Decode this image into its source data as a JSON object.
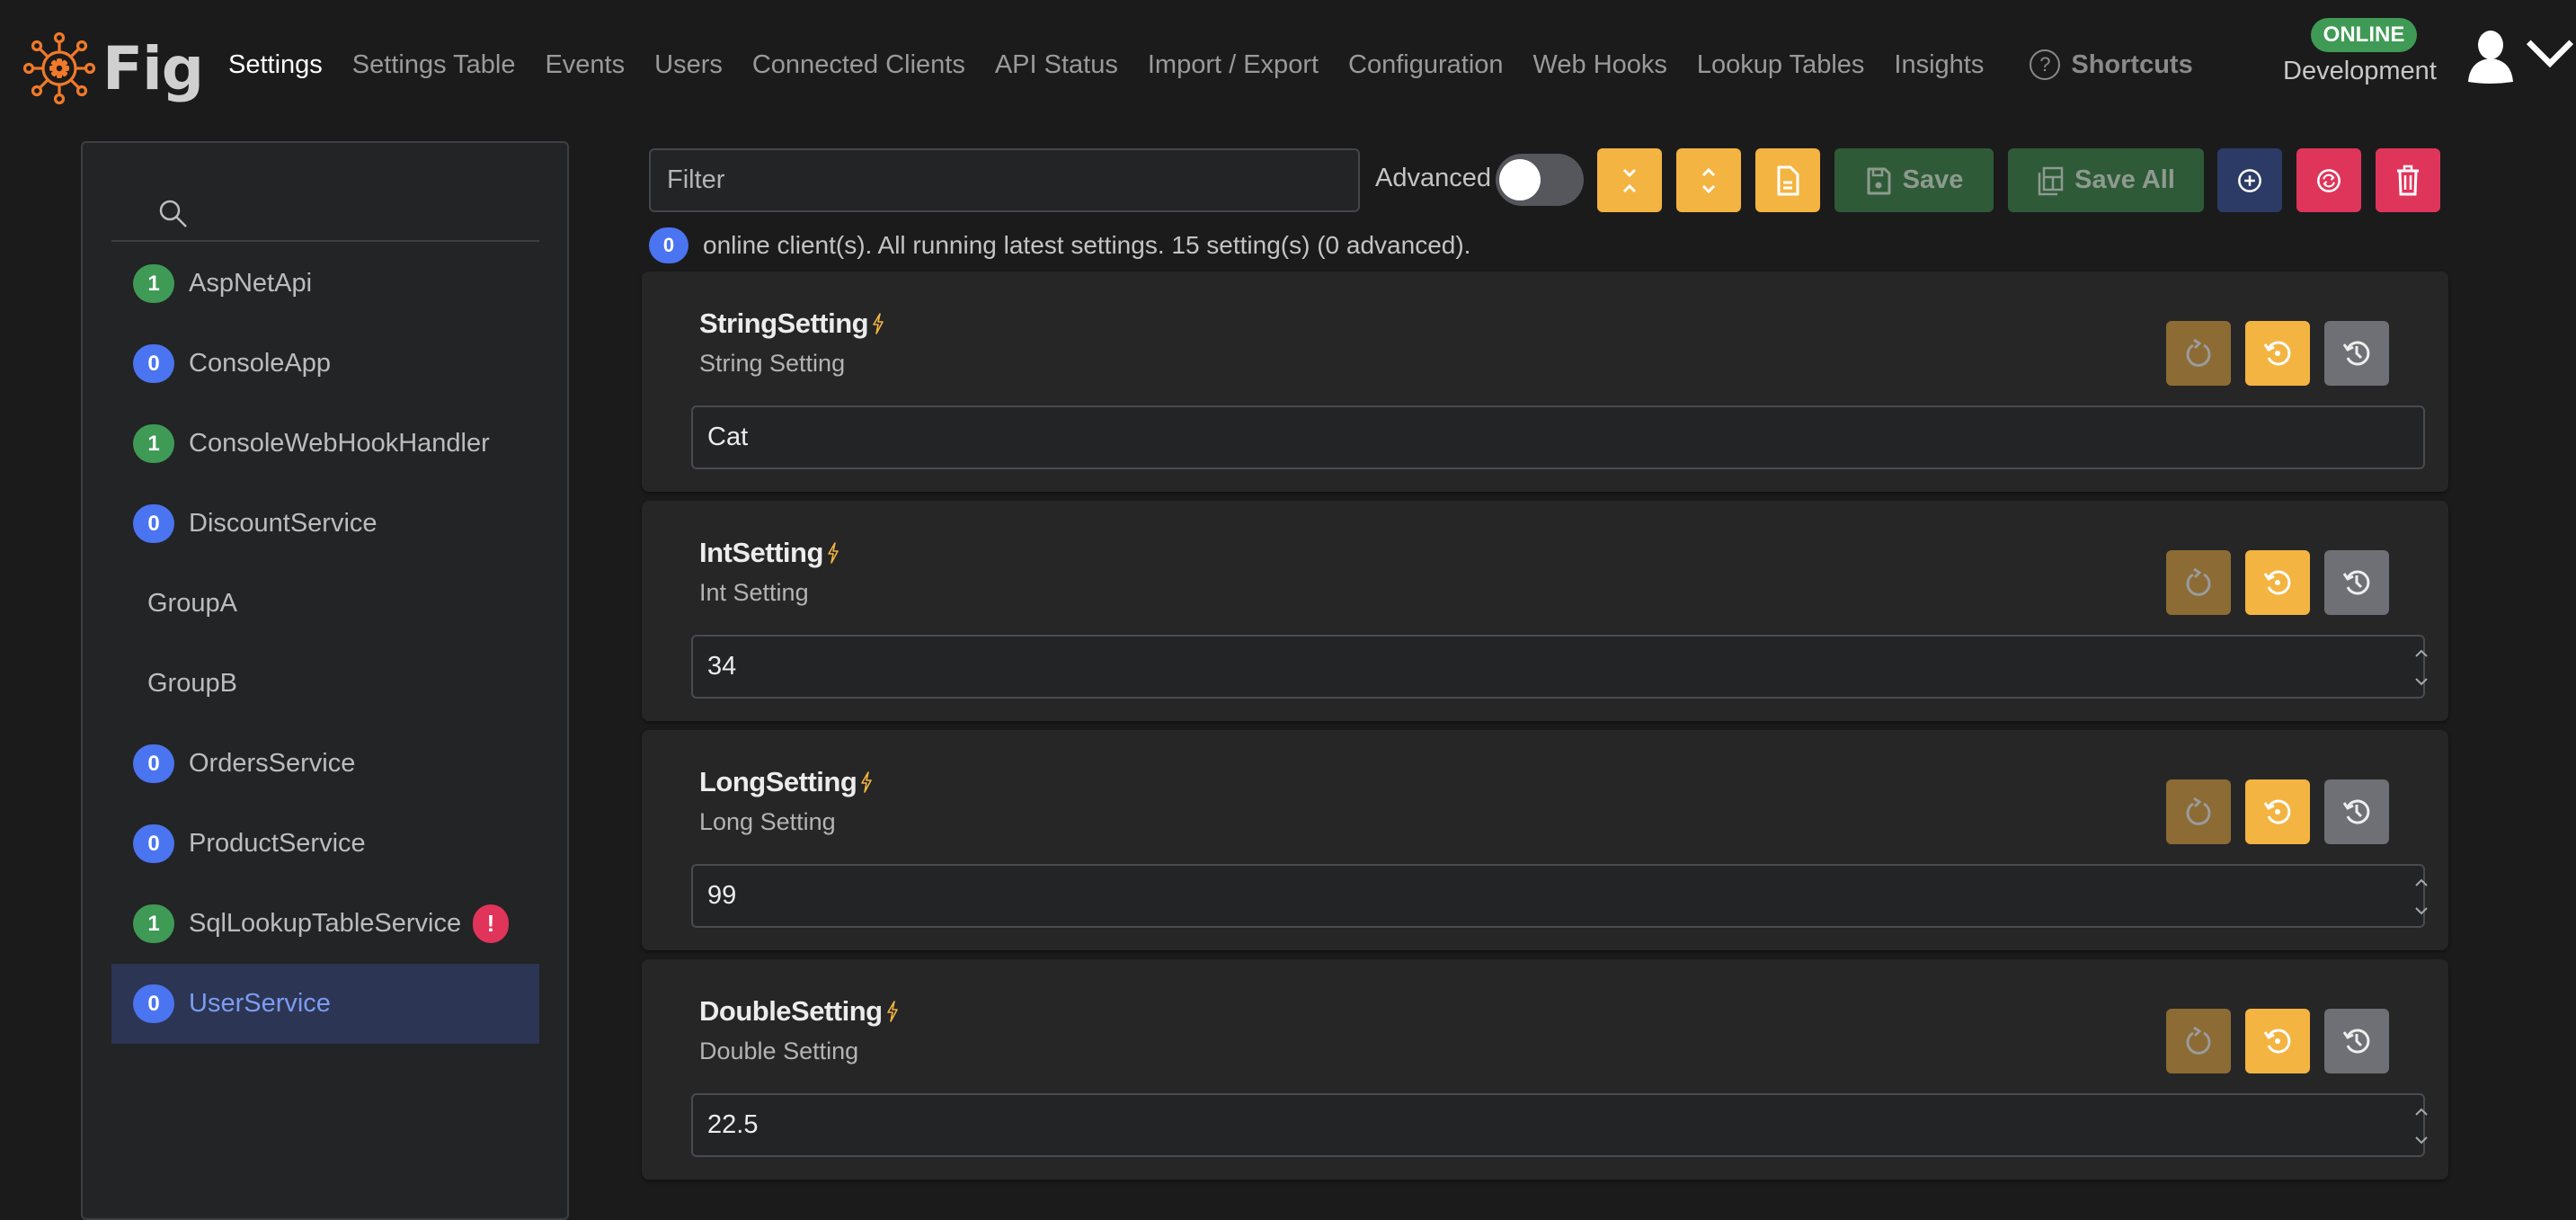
{
  "header": {
    "app_name": "Fig",
    "nav": [
      {
        "label": "Settings",
        "active": true
      },
      {
        "label": "Settings Table",
        "active": false
      },
      {
        "label": "Events",
        "active": false
      },
      {
        "label": "Users",
        "active": false
      },
      {
        "label": "Connected Clients",
        "active": false
      },
      {
        "label": "API Status",
        "active": false
      },
      {
        "label": "Import / Export",
        "active": false
      },
      {
        "label": "Configuration",
        "active": false
      },
      {
        "label": "Web Hooks",
        "active": false
      },
      {
        "label": "Lookup Tables",
        "active": false
      },
      {
        "label": "Insights",
        "active": false
      }
    ],
    "shortcuts_label": "Shortcuts",
    "shortcuts_icon": "question-circle-icon",
    "status_badge": "ONLINE",
    "environment": "Development",
    "user_icon": "user-avatar-icon"
  },
  "sidebar": {
    "search_placeholder": "",
    "items": [
      {
        "label": "AspNetApi",
        "count": "1",
        "badge_color": "green",
        "error": false,
        "selected": false,
        "group": false
      },
      {
        "label": "ConsoleApp",
        "count": "0",
        "badge_color": "blue",
        "error": false,
        "selected": false,
        "group": false
      },
      {
        "label": "ConsoleWebHookHandler",
        "count": "1",
        "badge_color": "green",
        "error": false,
        "selected": false,
        "group": false
      },
      {
        "label": "DiscountService",
        "count": "0",
        "badge_color": "blue",
        "error": false,
        "selected": false,
        "group": false
      },
      {
        "label": "GroupA",
        "count": null,
        "badge_color": null,
        "error": false,
        "selected": false,
        "group": true
      },
      {
        "label": "GroupB",
        "count": null,
        "badge_color": null,
        "error": false,
        "selected": false,
        "group": true
      },
      {
        "label": "OrdersService",
        "count": "0",
        "badge_color": "blue",
        "error": false,
        "selected": false,
        "group": false
      },
      {
        "label": "ProductService",
        "count": "0",
        "badge_color": "blue",
        "error": false,
        "selected": false,
        "group": false
      },
      {
        "label": "SqlLookupTableService",
        "count": "1",
        "badge_color": "green",
        "error": true,
        "error_glyph": "!",
        "selected": false,
        "group": false
      },
      {
        "label": "UserService",
        "count": "0",
        "badge_color": "blue",
        "error": false,
        "selected": true,
        "group": false
      }
    ]
  },
  "toolbar": {
    "filter_placeholder": "Filter",
    "filter_value": "",
    "advanced_label": "Advanced",
    "advanced_on": false,
    "buttons": {
      "collapse_all_icon": "collapse-all-icon",
      "expand_all_icon": "expand-all-icon",
      "description_icon": "document-icon",
      "save_label": "Save",
      "save_all_label": "Save All",
      "add_instance_icon": "plus-circle-icon",
      "refresh_icon": "refresh-circle-icon",
      "delete_icon": "trash-icon"
    }
  },
  "status": {
    "online_count": "0",
    "message": "online client(s). All running latest settings. 15 setting(s) (0 advanced)."
  },
  "settings": [
    {
      "name": "StringSetting",
      "description": "String Setting",
      "value": "Cat",
      "type": "text",
      "live_reload": true
    },
    {
      "name": "IntSetting",
      "description": "Int Setting",
      "value": "34",
      "type": "number",
      "live_reload": true
    },
    {
      "name": "LongSetting",
      "description": "Long Setting",
      "value": "99",
      "type": "number",
      "live_reload": true
    },
    {
      "name": "DoubleSetting",
      "description": "Double Setting",
      "value": "22.5",
      "type": "number",
      "live_reload": true
    }
  ],
  "colors": {
    "accent_amber": "#f4b441",
    "online_green": "#3f9a55",
    "badge_blue": "#4a74f0",
    "danger_red": "#e0355a",
    "logo_orange": "#f07a2a",
    "selected_bg": "#2c3553"
  }
}
